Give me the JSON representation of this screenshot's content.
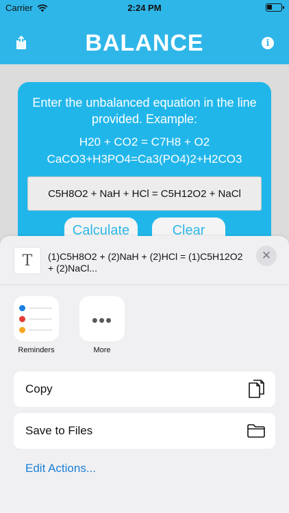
{
  "status_bar": {
    "carrier": "Carrier",
    "time": "2:24 PM",
    "wifi_icon": "wifi-icon",
    "battery_icon": "battery-icon"
  },
  "app": {
    "title": "BALANCE",
    "share_icon": "share-icon",
    "info_icon": "info-icon",
    "info_glyph": "i"
  },
  "card": {
    "instructions": "Enter the unbalanced equation in the line provided. Example:",
    "example_1": "H20 + CO2 = C7H8 + O2",
    "example_2": "CaCO3+H3PO4=Ca3(PO4)2+H2CO3",
    "equation_value": "C5H8O2 + NaH + HCl = C5H12O2 + NaCl",
    "calculate_label": "Calculate",
    "clear_label": "Clear"
  },
  "share_sheet": {
    "preview_text": "(1)C5H8O2 + (2)NaH + (2)HCl = (1)C5H12O2 + (2)NaCl...",
    "thumb_glyph": "T",
    "close_glyph": "✕",
    "apps": [
      {
        "label": "Reminders",
        "icon": "reminders-icon"
      },
      {
        "label": "More",
        "icon": "more-icon",
        "glyph": "•••"
      }
    ],
    "actions": [
      {
        "label": "Copy",
        "icon": "copy-icon"
      },
      {
        "label": "Save to Files",
        "icon": "folder-icon"
      }
    ],
    "edit_actions_label": "Edit Actions..."
  },
  "colors": {
    "accent": "#2fb6e8",
    "card": "#21b6ea",
    "link": "#1a7fd6"
  }
}
